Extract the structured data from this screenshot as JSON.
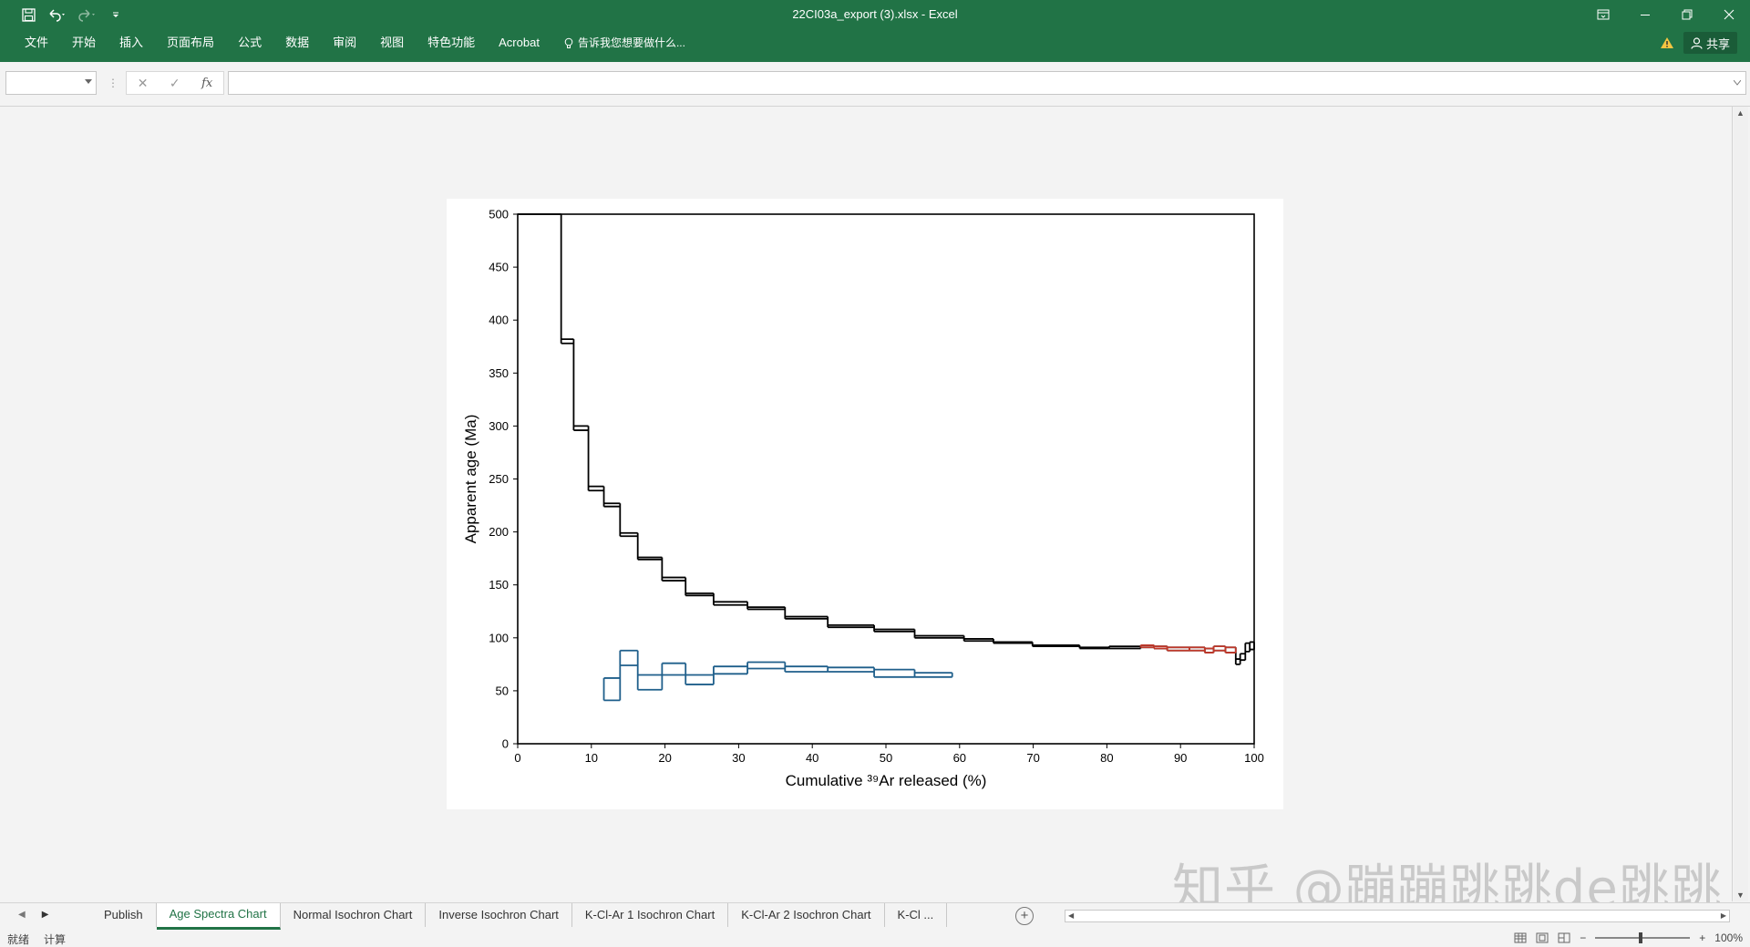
{
  "window": {
    "title": "22CI03a_export (3).xlsx - Excel"
  },
  "ribbon": {
    "tabs": [
      "文件",
      "开始",
      "插入",
      "页面布局",
      "公式",
      "数据",
      "审阅",
      "视图",
      "特色功能",
      "Acrobat"
    ],
    "tell_me": "告诉我您想要做什么...",
    "share_label": "共享"
  },
  "formula_bar": {
    "name_box": "",
    "formula": "",
    "fx_label": "fx"
  },
  "chart_data": {
    "type": "line",
    "subtype": "age-spectrum-step",
    "title": "",
    "ylabel": "Apparent age (Ma)",
    "xlabel": "Cumulative ³⁹Ar released (%)",
    "xlim": [
      0,
      100
    ],
    "ylim": [
      0,
      500
    ],
    "xticks": [
      0,
      10,
      20,
      30,
      40,
      50,
      60,
      70,
      80,
      90,
      100
    ],
    "yticks": [
      0,
      50,
      100,
      150,
      200,
      250,
      300,
      350,
      400,
      450,
      500
    ],
    "grid": false,
    "legend": "none",
    "series": [
      {
        "color": "#000000",
        "steps": [
          {
            "x0": 0,
            "x1": 5.9,
            "lo": 500,
            "hi": 500
          },
          {
            "x0": 5.9,
            "x1": 7.6,
            "lo": 378,
            "hi": 382
          },
          {
            "x0": 7.6,
            "x1": 9.6,
            "lo": 296,
            "hi": 300
          },
          {
            "x0": 9.6,
            "x1": 11.7,
            "lo": 239,
            "hi": 243
          },
          {
            "x0": 11.7,
            "x1": 13.9,
            "lo": 224,
            "hi": 227
          },
          {
            "x0": 13.9,
            "x1": 16.3,
            "lo": 196,
            "hi": 199
          },
          {
            "x0": 16.3,
            "x1": 19.6,
            "lo": 174,
            "hi": 176
          },
          {
            "x0": 19.6,
            "x1": 22.8,
            "lo": 154,
            "hi": 157
          },
          {
            "x0": 22.8,
            "x1": 26.6,
            "lo": 140,
            "hi": 142
          },
          {
            "x0": 26.6,
            "x1": 31.2,
            "lo": 131,
            "hi": 134
          },
          {
            "x0": 31.2,
            "x1": 36.3,
            "lo": 127,
            "hi": 129
          },
          {
            "x0": 36.3,
            "x1": 42.1,
            "lo": 118,
            "hi": 120
          },
          {
            "x0": 42.1,
            "x1": 48.4,
            "lo": 110,
            "hi": 112
          },
          {
            "x0": 48.4,
            "x1": 53.9,
            "lo": 106,
            "hi": 108
          },
          {
            "x0": 53.9,
            "x1": 60.6,
            "lo": 100,
            "hi": 102
          },
          {
            "x0": 60.6,
            "x1": 64.6,
            "lo": 97,
            "hi": 99
          },
          {
            "x0": 64.6,
            "x1": 69.9,
            "lo": 95,
            "hi": 96
          },
          {
            "x0": 69.9,
            "x1": 76.3,
            "lo": 92,
            "hi": 93
          },
          {
            "x0": 76.3,
            "x1": 80.3,
            "lo": 90,
            "hi": 91
          },
          {
            "x0": 80.3,
            "x1": 84.6,
            "lo": 90,
            "hi": 92
          },
          {
            "x0": 84.6,
            "x1": 86.4,
            "lo": 91,
            "hi": 93
          },
          {
            "x0": 86.4,
            "x1": 88.2,
            "lo": 90,
            "hi": 92
          },
          {
            "x0": 88.2,
            "x1": 91.2,
            "lo": 88,
            "hi": 91
          },
          {
            "x0": 91.2,
            "x1": 93.3,
            "lo": 88,
            "hi": 91
          },
          {
            "x0": 93.3,
            "x1": 94.5,
            "lo": 86,
            "hi": 90
          },
          {
            "x0": 94.5,
            "x1": 96.1,
            "lo": 88,
            "hi": 92
          },
          {
            "x0": 96.1,
            "x1": 97.5,
            "lo": 86,
            "hi": 91
          },
          {
            "x0": 97.5,
            "x1": 98.1,
            "lo": 75,
            "hi": 80
          },
          {
            "x0": 98.1,
            "x1": 98.8,
            "lo": 79,
            "hi": 85
          },
          {
            "x0": 98.8,
            "x1": 99.4,
            "lo": 87,
            "hi": 95
          },
          {
            "x0": 99.4,
            "x1": 100,
            "lo": 89,
            "hi": 96
          }
        ]
      },
      {
        "color": "#c0392b",
        "steps": [
          {
            "x0": 84.6,
            "x1": 86.4,
            "lo": 91,
            "hi": 93
          },
          {
            "x0": 86.4,
            "x1": 88.2,
            "lo": 90,
            "hi": 92
          },
          {
            "x0": 88.2,
            "x1": 91.2,
            "lo": 88,
            "hi": 91
          },
          {
            "x0": 91.2,
            "x1": 93.3,
            "lo": 88,
            "hi": 91
          },
          {
            "x0": 93.3,
            "x1": 94.5,
            "lo": 86,
            "hi": 90
          },
          {
            "x0": 94.5,
            "x1": 96.1,
            "lo": 88,
            "hi": 92
          },
          {
            "x0": 96.1,
            "x1": 97.5,
            "lo": 86,
            "hi": 91
          }
        ]
      },
      {
        "color": "#1f5f8b",
        "steps": [
          {
            "x0": 11.7,
            "x1": 13.9,
            "lo": 41,
            "hi": 62
          },
          {
            "x0": 13.9,
            "x1": 16.3,
            "lo": 74,
            "hi": 88
          },
          {
            "x0": 16.3,
            "x1": 19.6,
            "lo": 51,
            "hi": 65
          },
          {
            "x0": 19.6,
            "x1": 22.8,
            "lo": 65,
            "hi": 76
          },
          {
            "x0": 22.8,
            "x1": 26.6,
            "lo": 56,
            "hi": 65
          },
          {
            "x0": 26.6,
            "x1": 31.2,
            "lo": 66,
            "hi": 73
          },
          {
            "x0": 31.2,
            "x1": 36.3,
            "lo": 71,
            "hi": 77
          },
          {
            "x0": 36.3,
            "x1": 42.1,
            "lo": 68,
            "hi": 73
          },
          {
            "x0": 42.1,
            "x1": 48.4,
            "lo": 68,
            "hi": 72
          },
          {
            "x0": 48.4,
            "x1": 53.9,
            "lo": 63,
            "hi": 70
          },
          {
            "x0": 53.9,
            "x1": 59.0,
            "lo": 63,
            "hi": 67
          }
        ]
      }
    ]
  },
  "watermark": "知乎 @蹦蹦跳跳de跳跳",
  "sheet_tabs": [
    "Publish",
    "Age Spectra Chart",
    "Normal Isochron Chart",
    "Inverse Isochron Chart",
    "K-Cl-Ar 1 Isochron Chart",
    "K-Cl-Ar 2 Isochron Chart",
    "K-Cl ..."
  ],
  "active_sheet_index": 1,
  "status": {
    "ready": "就绪",
    "calc": "计算",
    "zoom": "100%"
  }
}
